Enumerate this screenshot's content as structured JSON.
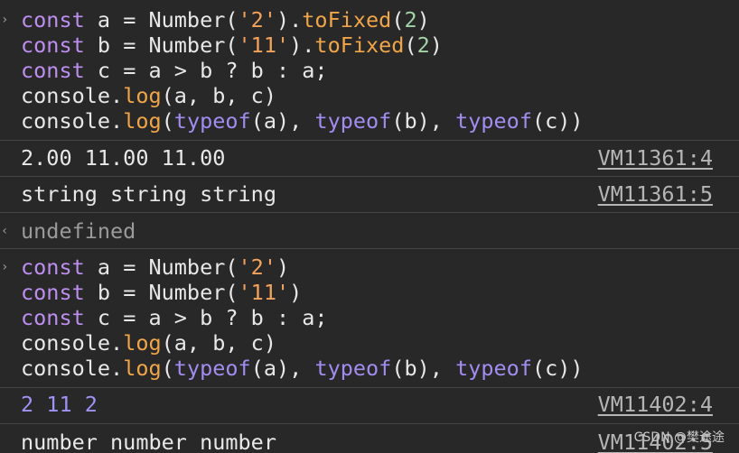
{
  "snippet1": {
    "line1": {
      "kw": "const",
      "mid": " a = Number(",
      "str": "'2'",
      "dot": ").",
      "fn": "toFixed",
      "open": "(",
      "num": "2",
      "close": ")"
    },
    "line2": {
      "kw": "const",
      "mid": " b = Number(",
      "str": "'11'",
      "dot": ").",
      "fn": "toFixed",
      "open": "(",
      "num": "2",
      "close": ")"
    },
    "line3": {
      "kw": "const",
      "rest": " c = a > b ? b : a;"
    },
    "line4": {
      "obj": "console.",
      "fn": "log",
      "rest": "(a, b, c)"
    },
    "line5": {
      "obj": "console.",
      "fn": "log",
      "p0": "(",
      "t1": "typeof",
      "p1": "(a), ",
      "t2": "typeof",
      "p2": "(b), ",
      "t3": "typeof",
      "p3": "(c))"
    }
  },
  "output1": [
    {
      "text": "2.00 11.00 11.00",
      "link": "VM11361:4"
    },
    {
      "text": "string string string",
      "link": "VM11361:5"
    }
  ],
  "return1": "undefined",
  "snippet2": {
    "line1": {
      "kw": "const",
      "mid": " a = Number(",
      "str": "'2'",
      "close": ")"
    },
    "line2": {
      "kw": "const",
      "mid": " b = Number(",
      "str": "'11'",
      "close": ")"
    },
    "line3": {
      "kw": "const",
      "rest": " c = a > b ? b : a;"
    },
    "line4": {
      "obj": "console.",
      "fn": "log",
      "rest": "(a, b, c)"
    },
    "line5": {
      "obj": "console.",
      "fn": "log",
      "p0": "(",
      "t1": "typeof",
      "p1": "(a), ",
      "t2": "typeof",
      "p2": "(b), ",
      "t3": "typeof",
      "p3": "(c))"
    }
  },
  "output2": [
    {
      "text": "2 11 2",
      "link": "VM11402:4"
    },
    {
      "text": "number number number",
      "link": "VM11402:5"
    }
  ],
  "watermark": "CSDN @樊途途",
  "colors": {
    "background": "#282828",
    "keyword": "#bd8ef0",
    "method": "#f0a548",
    "string": "#f3a35c",
    "number": "#a3d4a8",
    "typeof": "#a28cf0",
    "numeric_output": "#9f93f5",
    "link": "#b5b5b5"
  },
  "icons": {
    "input_prompt": "chevron-right-icon",
    "return_prompt": "chevron-left-icon"
  }
}
